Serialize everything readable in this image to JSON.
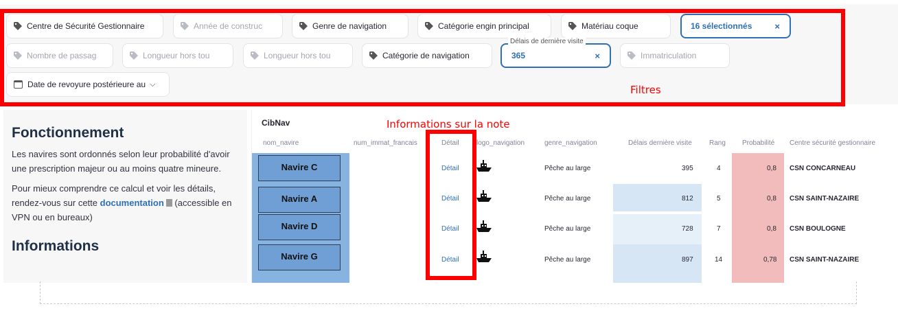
{
  "filters": {
    "row1": [
      {
        "label": "Centre de Sécurité Gestionnaire",
        "muted": false
      },
      {
        "label": "Année de construc",
        "muted": true
      },
      {
        "label": "Genre de navigation",
        "muted": false
      },
      {
        "label": "Catégorie engin principal",
        "muted": false
      },
      {
        "label": "Matériau coque",
        "muted": false
      }
    ],
    "selected_label": "16 sélectionnés",
    "selected_clear": "×",
    "row2": [
      {
        "label": "Nombre de passag",
        "muted": true
      },
      {
        "label": "Longueur hors tou",
        "muted": true
      },
      {
        "label": "Longueur hors tou",
        "muted": true
      },
      {
        "label": "Catégorie de navigation",
        "muted": false
      }
    ],
    "delay_legend": "Délais de dernière visite",
    "delay_value": "365",
    "delay_clear": "×",
    "immat_label": "Immatriculation",
    "date_label": "Date de revoyure postérieure au",
    "date_chevron": "⌵"
  },
  "annotations": {
    "filters_label": "Filtres",
    "note_label": "Informations sur la note",
    "color": "#ff0000"
  },
  "info": {
    "title": "Fonctionnement",
    "p1": "Les navires sont ordonnés selon leur probabilité d'avoir une prescription majeur ou au moins quatre mineure.",
    "p2_before": "Pour mieux comprendre ce calcul et voir les détails, rendez-vous sur cette ",
    "p2_link": "documentation",
    "p2_after": " (accessible en VPN ou en bureaux)",
    "title2": "Informations"
  },
  "table": {
    "title": "CibNav",
    "columns": [
      "nom_navire",
      "num_immat_francais",
      "Détail",
      "logo_navigation",
      "genre_navigation",
      "Délais dernière visite",
      "Rang",
      "Probabilité",
      "Centre sécurité gestionnaire"
    ],
    "rows": [
      {
        "nom_navire": "Navire C",
        "num_immat_francais": "",
        "detail": "Détail",
        "genre": "Pêche au large",
        "delai": "395",
        "rang": "4",
        "proba": "0,8",
        "centre": "CSN CONCARNEAU"
      },
      {
        "nom_navire": "Navire A",
        "num_immat_francais": "",
        "detail": "Détail",
        "genre": "Pêche au large",
        "delai": "812",
        "rang": "5",
        "proba": "0,8",
        "centre": "CSN SAINT-NAZAIRE"
      },
      {
        "nom_navire": "Navire D",
        "num_immat_francais": "",
        "detail": "Détail",
        "genre": "Pêche au large",
        "delai": "728",
        "rang": "7",
        "proba": "0,8",
        "centre": "CSN BOULOGNE"
      },
      {
        "nom_navire": "Navire G",
        "num_immat_francais": "",
        "detail": "Détail",
        "genre": "Pêche au large",
        "delai": "897",
        "rang": "14",
        "proba": "0,78",
        "centre": "CSN SAINT-NAZAIRE"
      }
    ]
  },
  "colors": {
    "accent": "#2e6fb5",
    "name_column": "#86b3e0",
    "delay_column": "#d6e6f5",
    "proba_column": "#f3bcbc"
  }
}
